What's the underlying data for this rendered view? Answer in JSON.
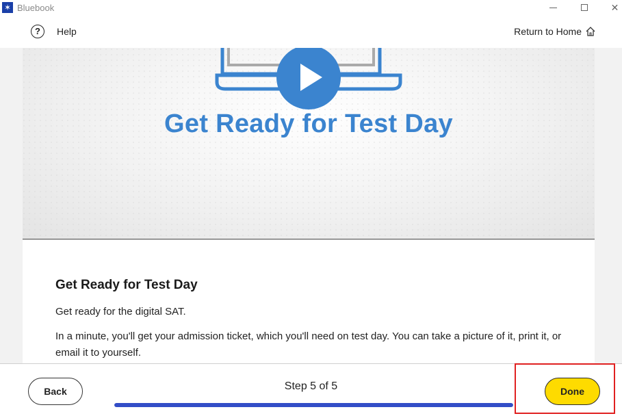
{
  "window": {
    "title": "Bluebook",
    "app_icon": "bluebook-logo-icon",
    "controls": [
      "minimize-icon",
      "maximize-icon",
      "close-icon"
    ]
  },
  "header": {
    "help_label": "Help",
    "help_icon": "question-circle-icon",
    "return_home_label": "Return to Home",
    "home_icon": "home-icon"
  },
  "video": {
    "title": "Get Ready for Test Day",
    "play_icon": "play-icon",
    "accent_color": "#3b84cf"
  },
  "content": {
    "heading": "Get Ready for Test Day",
    "intro": "Get ready for the digital SAT.",
    "body": "In a minute, you'll get your admission ticket, which you'll need on test day. You can take a picture of it, print it, or email it to yourself."
  },
  "footer": {
    "back_label": "Back",
    "step_text": "Step 5 of 5",
    "progress": 1.0,
    "done_label": "Done",
    "done_color": "#fedb00",
    "progress_color": "#324dc7"
  }
}
